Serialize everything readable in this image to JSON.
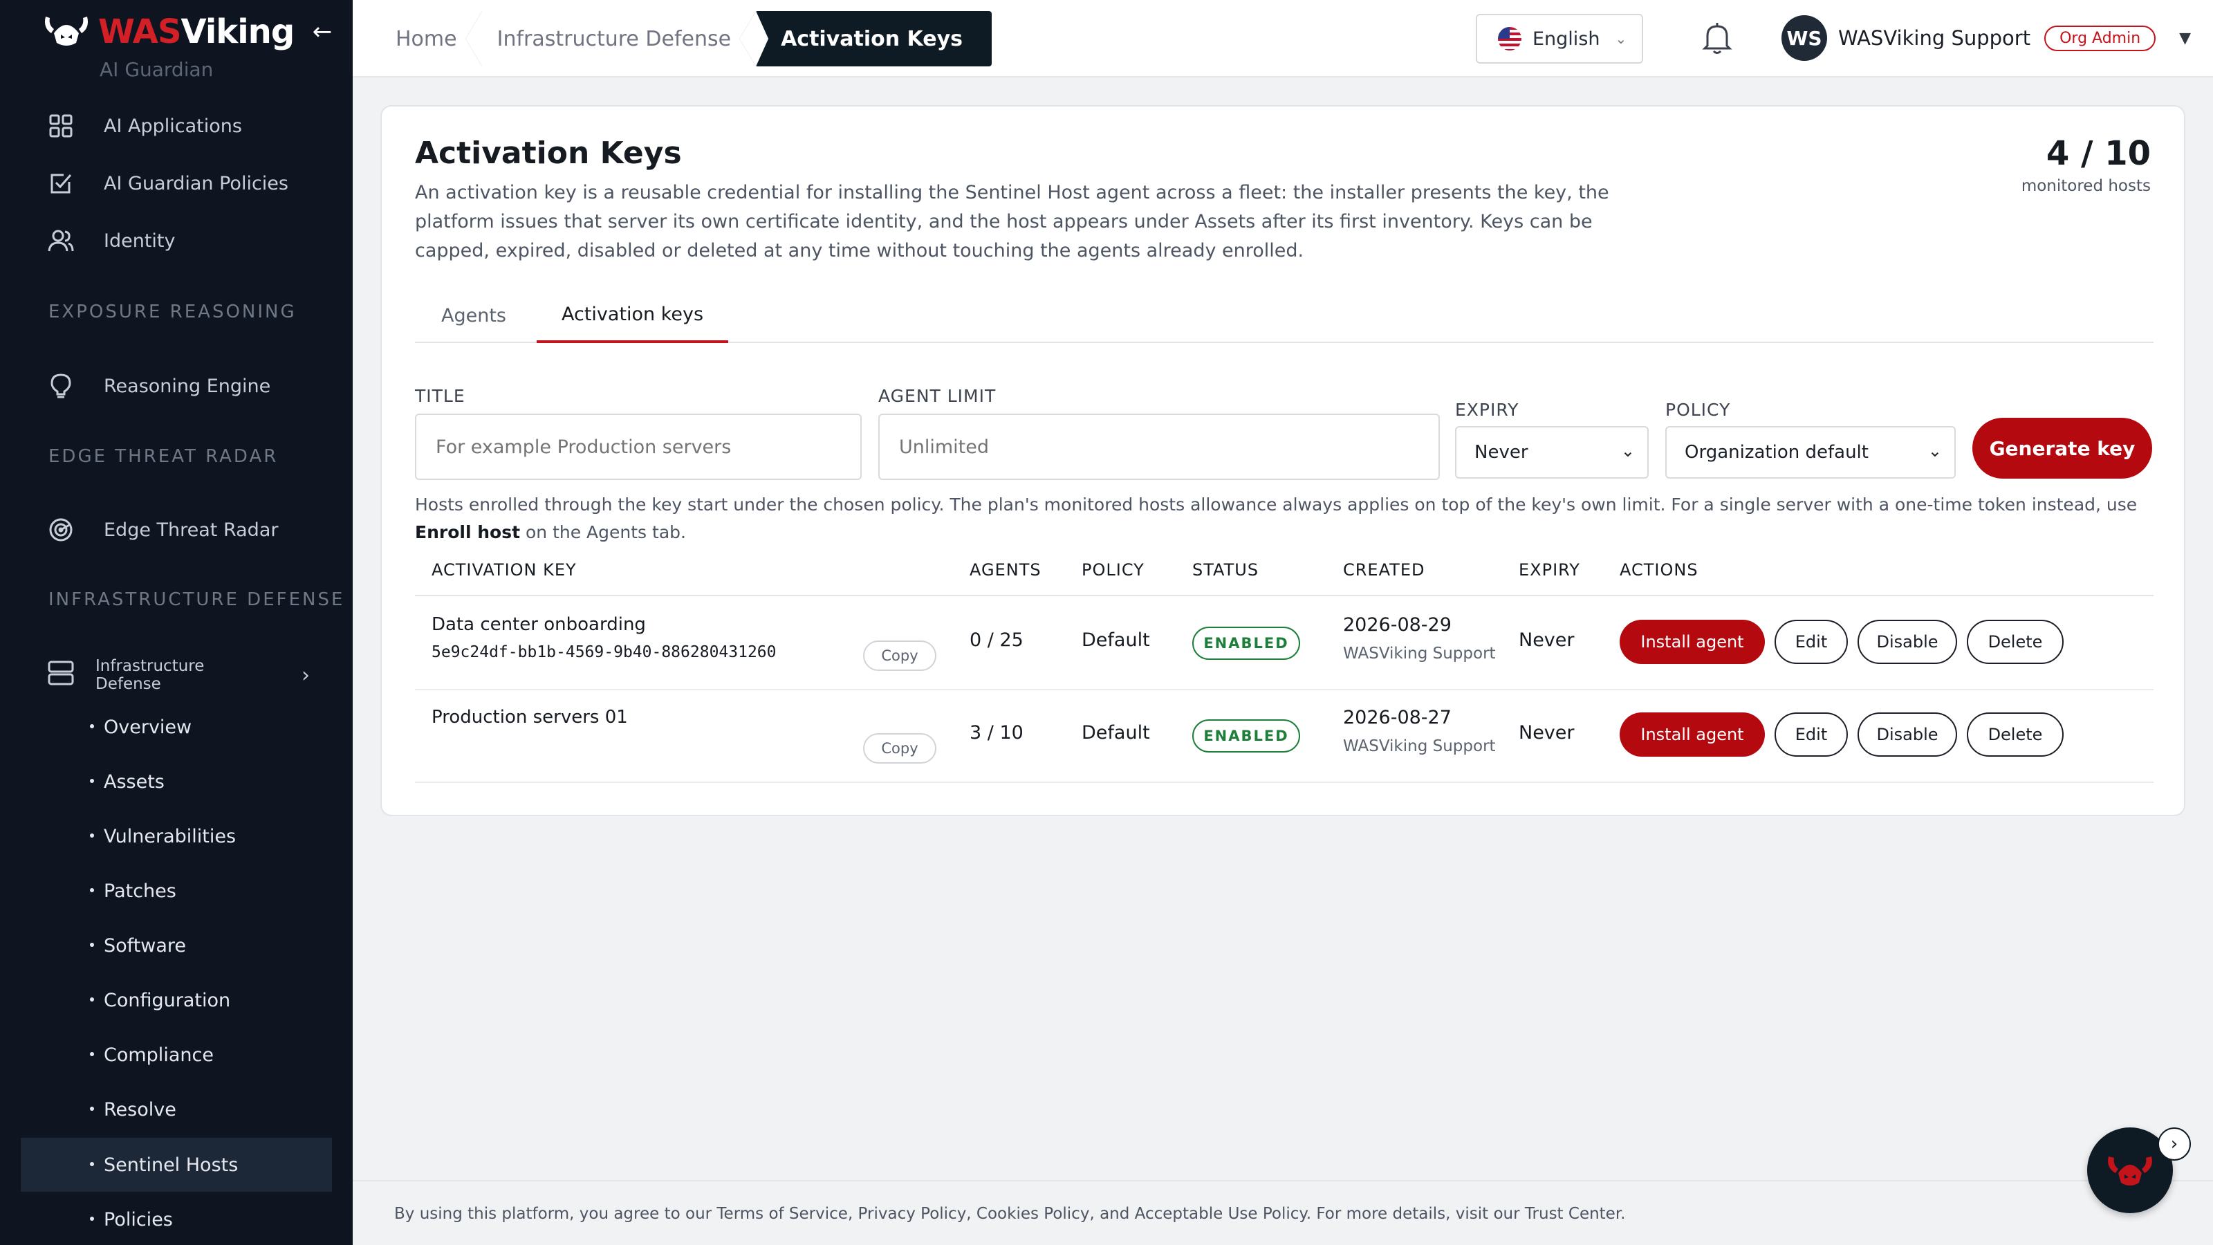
{
  "brand": {
    "was": "WAS",
    "viking": "Viking"
  },
  "sidebar": {
    "clipped_item": "AI Guardian",
    "top_items": [
      {
        "label": "AI Applications",
        "icon": "grid-icon"
      },
      {
        "label": "AI Guardian Policies",
        "icon": "checkbox-icon"
      },
      {
        "label": "Identity",
        "icon": "users-icon"
      }
    ],
    "sections": {
      "exposure": "EXPOSURE REASONING",
      "edge": "EDGE THREAT RADAR",
      "infra": "INFRASTRUCTURE DEFENSE"
    },
    "reasoning_engine": "Reasoning Engine",
    "edge_threat_radar": "Edge Threat Radar",
    "infra_group": "Infrastructure Defense",
    "sub_items": [
      {
        "label": "Overview"
      },
      {
        "label": "Assets"
      },
      {
        "label": "Vulnerabilities"
      },
      {
        "label": "Patches"
      },
      {
        "label": "Software"
      },
      {
        "label": "Configuration"
      },
      {
        "label": "Compliance"
      },
      {
        "label": "Resolve"
      },
      {
        "label": "Sentinel Hosts"
      },
      {
        "label": "Policies"
      }
    ],
    "active_item": "Sentinel Hosts"
  },
  "topbar": {
    "breadcrumbs": [
      "Home",
      "Infrastructure Defense",
      "Activation Keys"
    ],
    "language": "English",
    "user_initials": "WS",
    "user_name": "WASViking Support",
    "role_badge": "Org Admin"
  },
  "page": {
    "title": "Activation Keys",
    "description": "An activation key is a reusable credential for installing the Sentinel Host agent across a fleet: the installer presents the key, the platform issues that server its own certificate identity, and the host appears under Assets after its first inventory. Keys can be capped, expired, disabled or deleted at any time without touching the agents already enrolled.",
    "monitored_count": "4 / 10",
    "monitored_label": "monitored hosts",
    "tabs": [
      "Agents",
      "Activation keys"
    ],
    "active_tab": "Activation keys"
  },
  "form": {
    "title_label": "TITLE",
    "title_placeholder": "For example Production servers",
    "agent_limit_label": "AGENT LIMIT",
    "agent_limit_placeholder": "Unlimited",
    "expiry_label": "EXPIRY",
    "expiry_value": "Never",
    "policy_label": "POLICY",
    "policy_value": "Organization default",
    "generate_button": "Generate key"
  },
  "hint": {
    "text_before": "Hosts enrolled through the key start under the chosen policy. The plan's monitored hosts allowance always applies on top of the key's own limit. For a single server with a one-time token instead, use ",
    "bold": "Enroll host",
    "text_after": " on the Agents tab."
  },
  "table": {
    "headers": [
      "ACTIVATION KEY",
      "AGENTS",
      "POLICY",
      "STATUS",
      "CREATED",
      "EXPIRY",
      "ACTIONS"
    ],
    "rows": [
      {
        "name": "Data center onboarding",
        "key": "5e9c24df-bb1b-4569-9b40-886280431260",
        "copy": "Copy",
        "agents": "0 / 25",
        "policy": "Default",
        "status": "ENABLED",
        "created_date": "2026-08-29",
        "created_by": "WASViking Support",
        "expiry": "Never",
        "actions": [
          "Install agent",
          "Edit",
          "Disable",
          "Delete"
        ]
      },
      {
        "name": "Production servers 01",
        "key": "",
        "copy": "Copy",
        "agents": "3 / 10",
        "policy": "Default",
        "status": "ENABLED",
        "created_date": "2026-08-27",
        "created_by": "WASViking Support",
        "expiry": "Never",
        "actions": [
          "Install agent",
          "Edit",
          "Disable",
          "Delete"
        ]
      }
    ]
  },
  "footer": {
    "text": "By using this platform, you agree to our Terms of Service, Privacy Policy, Cookies Policy, and Acceptable Use Policy. For more details, visit our Trust Center."
  },
  "colors": {
    "brand_red": "#b3090f",
    "sidebar_bg": "#0f1520",
    "status_green": "#1e7f3a"
  }
}
